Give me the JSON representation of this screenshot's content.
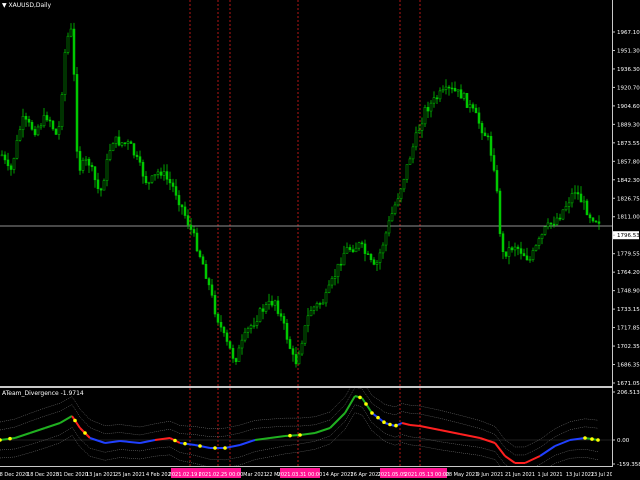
{
  "symbol": "XAUUSD,Daily",
  "indicator_label": "ATeam_Divergence -1.9714",
  "current_price": "1796.53",
  "colors": {
    "background": "#000000",
    "candle": "#00c800",
    "divergence_line": "#ff2020",
    "price_line": "#c0c0c0",
    "ind_green": "#20b020",
    "ind_red": "#ff2020",
    "ind_blue": "#2040ff",
    "ind_yellow": "#ffff00",
    "band": "#808080",
    "date_highlight": "#ff1493"
  },
  "price_axis": [
    "1967.10",
    "1951.30",
    "1936.30",
    "1920.70",
    "1904.60",
    "1889.30",
    "1873.55",
    "1857.80",
    "1842.30",
    "1826.75",
    "1811.00",
    "1796.53",
    "1779.55",
    "1764.20",
    "1748.90",
    "1733.15",
    "1717.85",
    "1702.35",
    "1686.35",
    "1671.05"
  ],
  "indicator_axis": [
    "206.5137",
    "0.00",
    "-159.3584"
  ],
  "time_axis": [
    {
      "label": "8 Dec 2020",
      "hl": false
    },
    {
      "label": "18 Dec 2020",
      "hl": false
    },
    {
      "label": "31 Dec 2020",
      "hl": false
    },
    {
      "label": "13 Jan 2021",
      "hl": false
    },
    {
      "label": "25 Jan 2021",
      "hl": false
    },
    {
      "label": "4 Feb 2021",
      "hl": false
    },
    {
      "label": "2021.02.19 00:00",
      "hl": true
    },
    {
      "label": "2021.02.25 00:00",
      "hl": true
    },
    {
      "label": "Mar 2021",
      "hl": false
    },
    {
      "label": "22 Mar 2021",
      "hl": false
    },
    {
      "label": "2021.03.31 00:00",
      "hl": true
    },
    {
      "label": "14 Apr 2021",
      "hl": false
    },
    {
      "label": "26 Apr 2021",
      "hl": false
    },
    {
      "label": "2021.05.05 00:00",
      "hl": true
    },
    {
      "label": "2021.05.13 00:00",
      "hl": true
    },
    {
      "label": "28 May 2021",
      "hl": false
    },
    {
      "label": "9 Jun 2021",
      "hl": false
    },
    {
      "label": "21 Jun 2021",
      "hl": false
    },
    {
      "label": "1 Jul 2021",
      "hl": false
    },
    {
      "label": "13 Jul 2021",
      "hl": false
    },
    {
      "label": "23 Jul 2021",
      "hl": false
    }
  ]
}
